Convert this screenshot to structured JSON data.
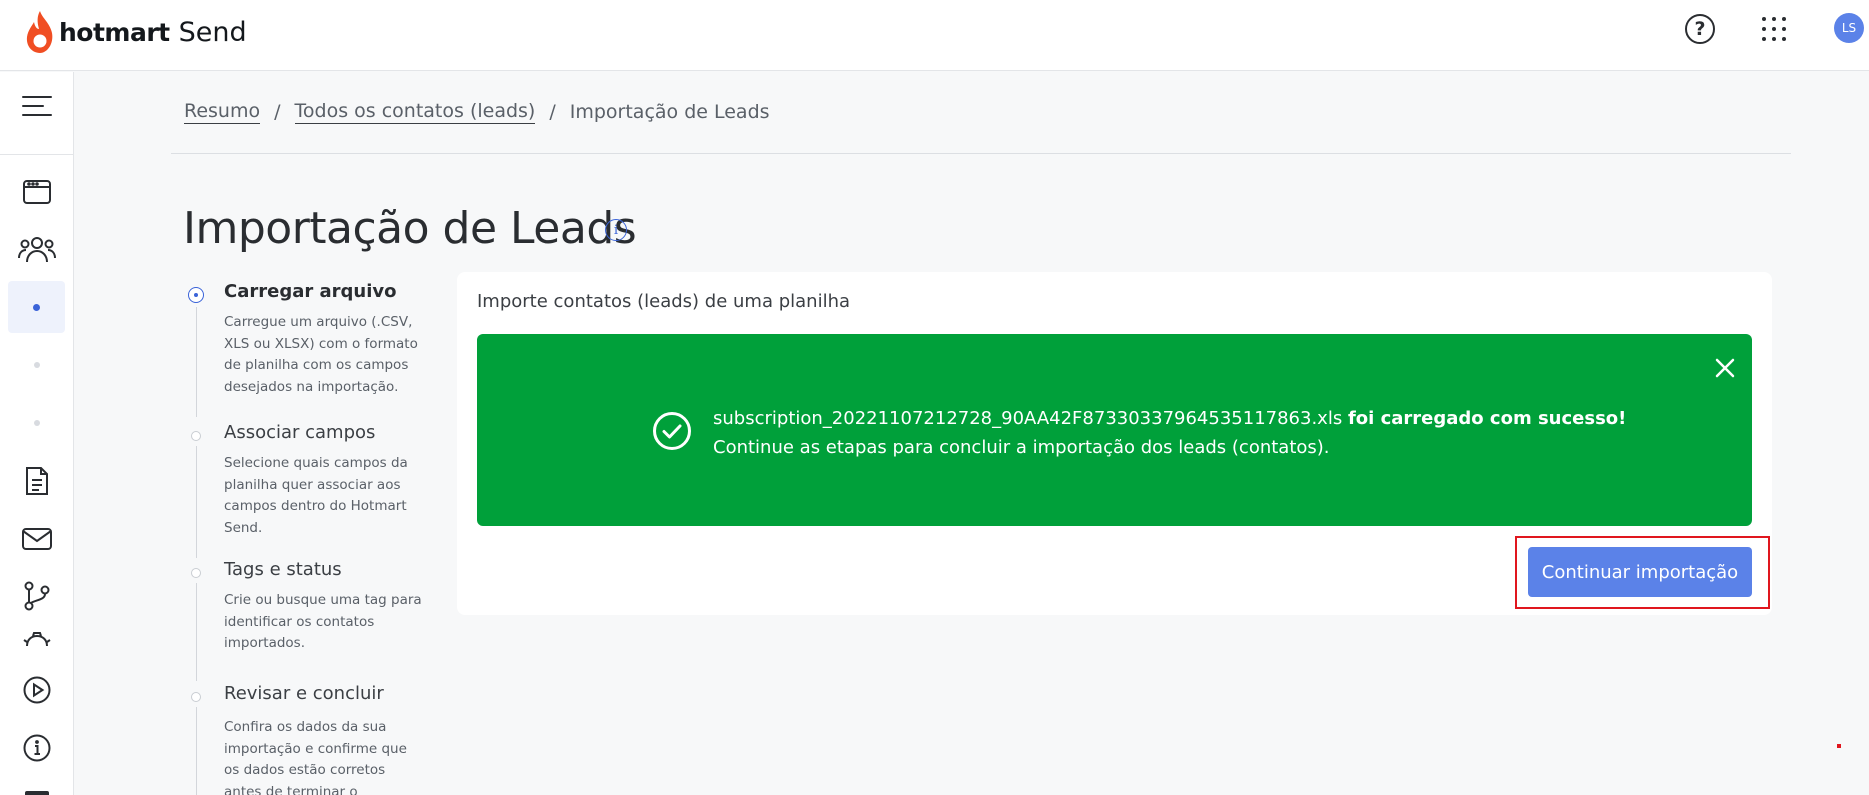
{
  "brand": {
    "name_bold": "hotmart",
    "name_light": "Send"
  },
  "header": {
    "help_icon": "help-circle-icon",
    "apps_icon": "apps-grid-icon",
    "avatar_initials": "LS"
  },
  "sidebar": {
    "items": [
      {
        "name": "menu-toggle",
        "icon": "menu-icon"
      },
      {
        "name": "dashboard",
        "icon": "window-icon"
      },
      {
        "name": "contacts",
        "icon": "users-icon"
      },
      {
        "name": "sub-step-1",
        "icon": "dot-icon",
        "active": true
      },
      {
        "name": "sub-step-2",
        "icon": "dot-icon"
      },
      {
        "name": "sub-step-3",
        "icon": "dot-icon"
      },
      {
        "name": "forms",
        "icon": "document-icon"
      },
      {
        "name": "email",
        "icon": "mail-icon"
      },
      {
        "name": "automation",
        "icon": "flow-icon"
      },
      {
        "name": "settings",
        "icon": "gear-icon"
      },
      {
        "name": "videos",
        "icon": "play-icon"
      },
      {
        "name": "info",
        "icon": "info-icon"
      }
    ]
  },
  "breadcrumb": {
    "items": [
      "Resumo",
      "Todos os contatos (leads)",
      "Importação de Leads"
    ],
    "separator": "/"
  },
  "page": {
    "title": "Importação de Leads",
    "info_icon": "info-icon"
  },
  "steps": [
    {
      "title": "Carregar arquivo",
      "description": "Carregue um arquivo (.CSV, XLS ou XLSX) com o formato de planilha com os campos desejados na importação.",
      "current": true
    },
    {
      "title": "Associar campos",
      "description": "Selecione quais campos da planilha quer associar aos campos dentro do Hotmart Send.",
      "current": false
    },
    {
      "title": "Tags e status",
      "description": "Crie ou busque uma tag para identificar os contatos importados.",
      "current": false
    },
    {
      "title": "Revisar e concluir",
      "description": "Confira os dados da sua importação e confirme que os dados estão corretos antes de terminar o processo.",
      "current": false
    }
  ],
  "card": {
    "heading": "Importe contatos (leads) de uma planilha",
    "alert": {
      "filename": "subscription_20221107212728_90AA42F87330337964535117863.xls",
      "success_bold": "foi carregado com sucesso!",
      "line2": "Continue as etapas para concluir a importação dos leads (contatos).",
      "color": "#00a03a"
    },
    "continue_button": "Continuar importação"
  },
  "colors": {
    "accent": "#5b82e8",
    "highlight": "#e0161e",
    "brand_flame": "#f04e23"
  }
}
